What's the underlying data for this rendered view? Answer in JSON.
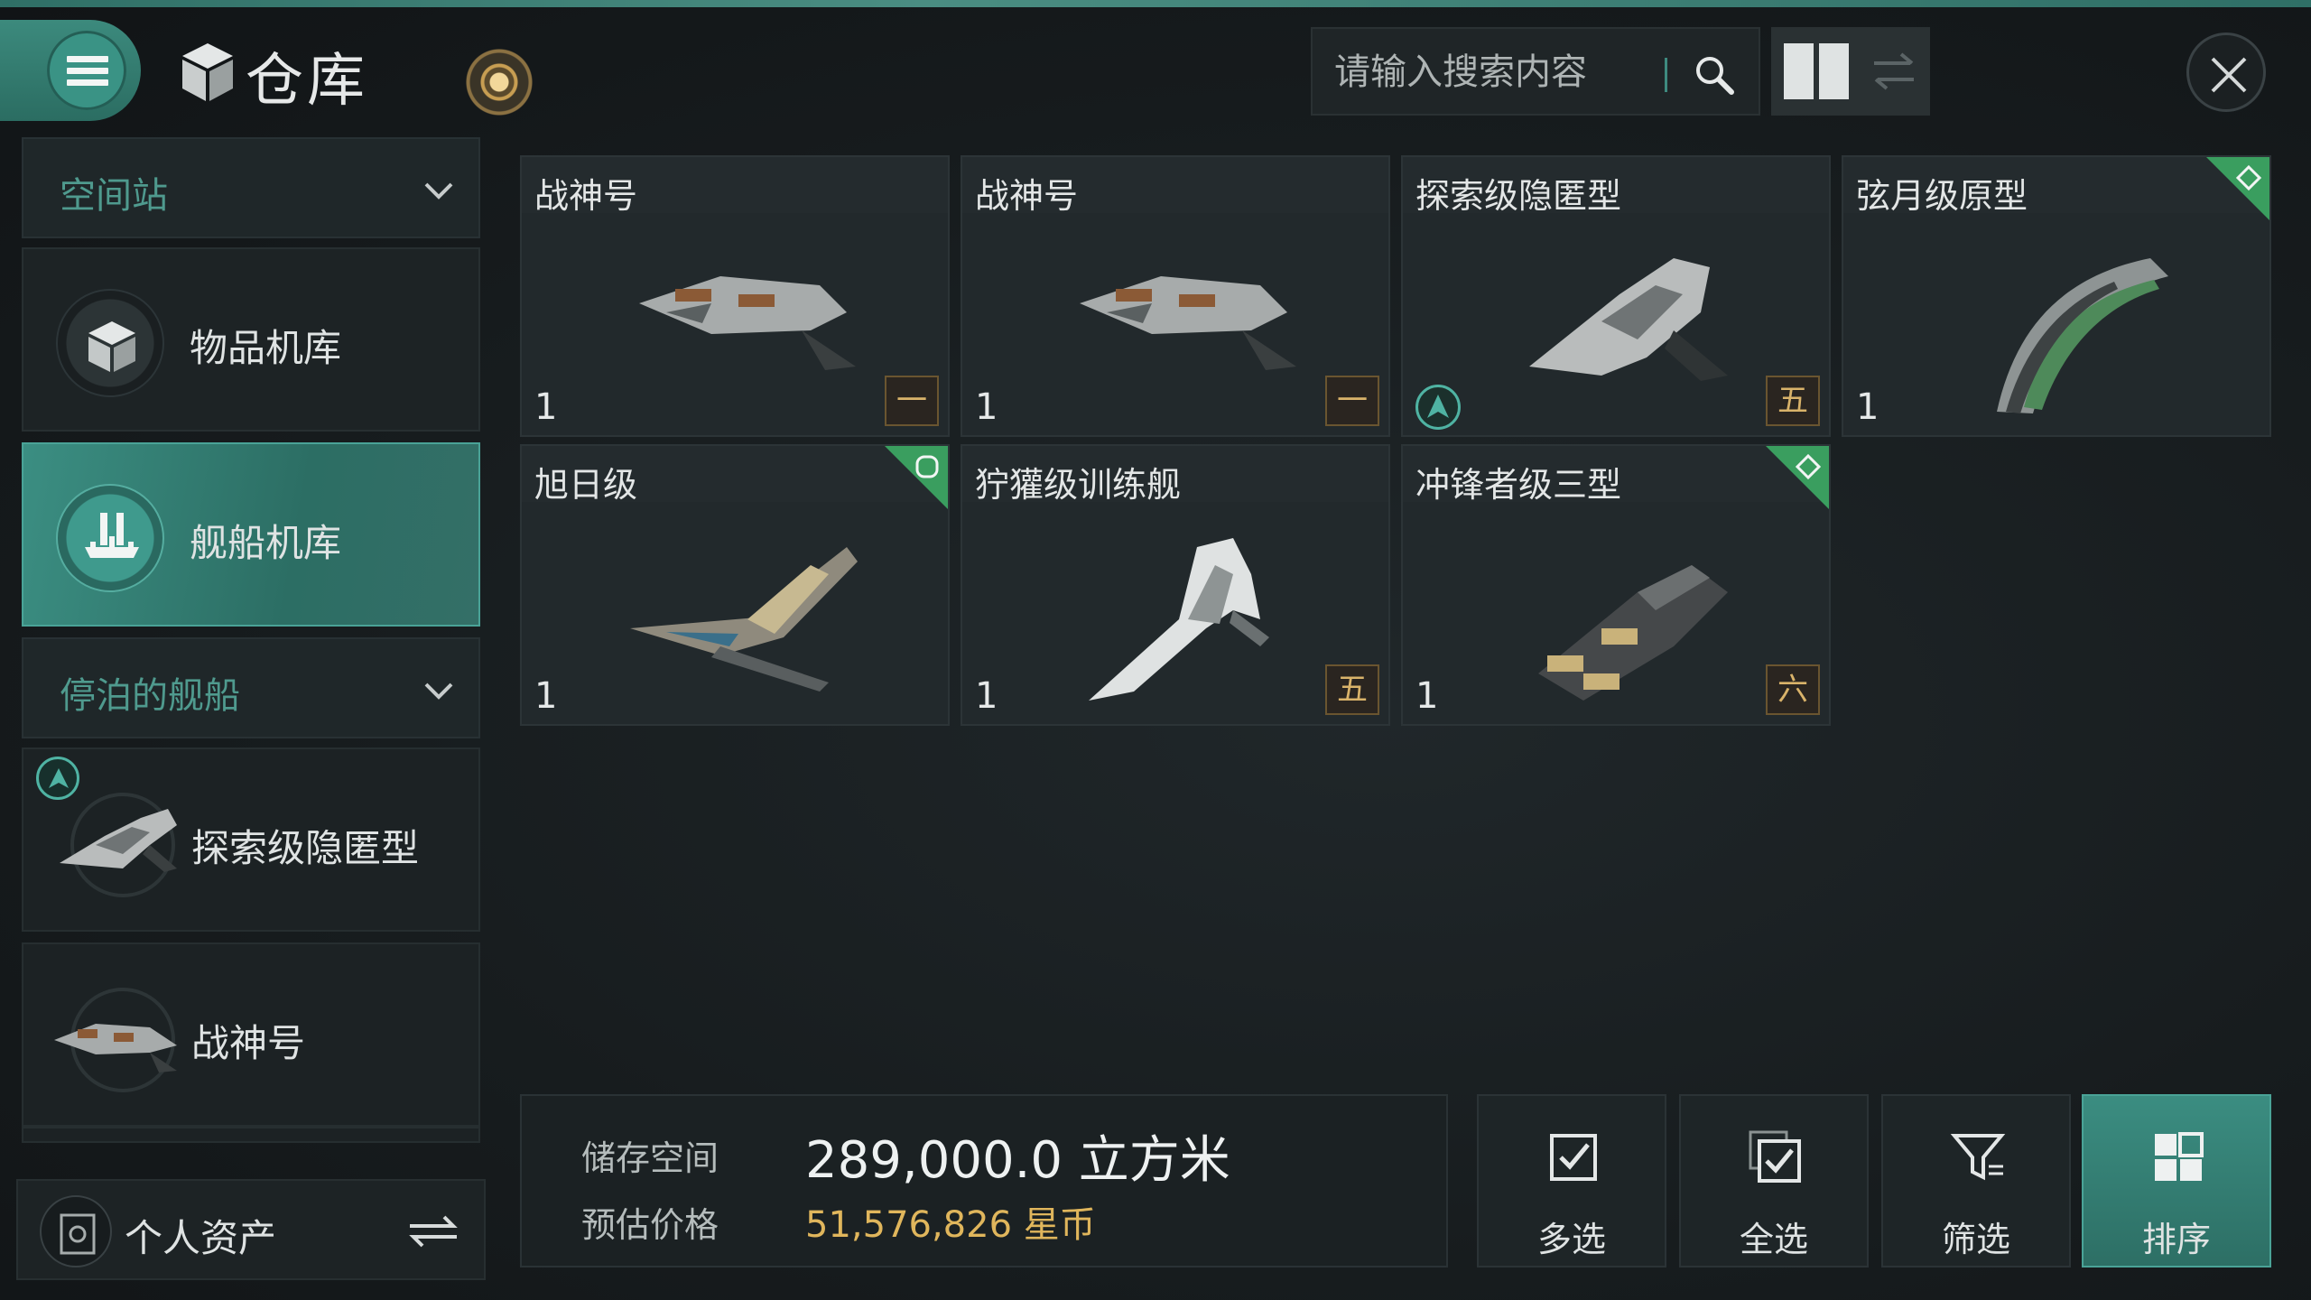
{
  "header": {
    "title": "仓库",
    "search_placeholder": "请输入搜索内容"
  },
  "sidebar": {
    "location_section": "空间站",
    "nav_items": [
      {
        "label": "物品机库",
        "icon": "cube-icon",
        "active": false
      },
      {
        "label": "舰船机库",
        "icon": "ship-hangar-icon",
        "active": true
      }
    ],
    "docked_section": "停泊的舰船",
    "docked_ships": [
      {
        "label": "探索级隐匿型",
        "active_ship": true
      },
      {
        "label": "战神号",
        "active_ship": false
      }
    ],
    "assets_label": "个人资产"
  },
  "ships": [
    {
      "name": "战神号",
      "qty": "1",
      "tier": "一",
      "corner": null,
      "skill_badge": false
    },
    {
      "name": "战神号",
      "qty": "1",
      "tier": "一",
      "corner": null,
      "skill_badge": false
    },
    {
      "name": "探索级隐匿型",
      "qty": "",
      "tier": "五",
      "corner": null,
      "skill_badge": true
    },
    {
      "name": "弦月级原型",
      "qty": "1",
      "tier": null,
      "corner": "diamond-icon",
      "skill_badge": false
    },
    {
      "name": "旭日级",
      "qty": "1",
      "tier": null,
      "corner": "circle-icon",
      "skill_badge": false
    },
    {
      "name": "狞獾级训练舰",
      "qty": "1",
      "tier": "五",
      "corner": null,
      "skill_badge": false
    },
    {
      "name": "冲锋者级三型",
      "qty": "1",
      "tier": "六",
      "corner": "diamond-icon",
      "skill_badge": false
    }
  ],
  "storage": {
    "space_label": "储存空间",
    "space_value": "289,000.0 立方米",
    "price_label": "预估价格",
    "price_value": "51,576,826 星币"
  },
  "actions": [
    {
      "label": "多选",
      "icon": "multi-select-icon",
      "active": false
    },
    {
      "label": "全选",
      "icon": "select-all-icon",
      "active": false
    },
    {
      "label": "筛选",
      "icon": "filter-icon",
      "active": false
    },
    {
      "label": "排序",
      "icon": "sort-icon",
      "active": true
    }
  ],
  "colors": {
    "accent": "#3b8e82",
    "price": "#e0b65c",
    "tier": "#d9b36a",
    "corner_green": "#3a9e5f"
  }
}
